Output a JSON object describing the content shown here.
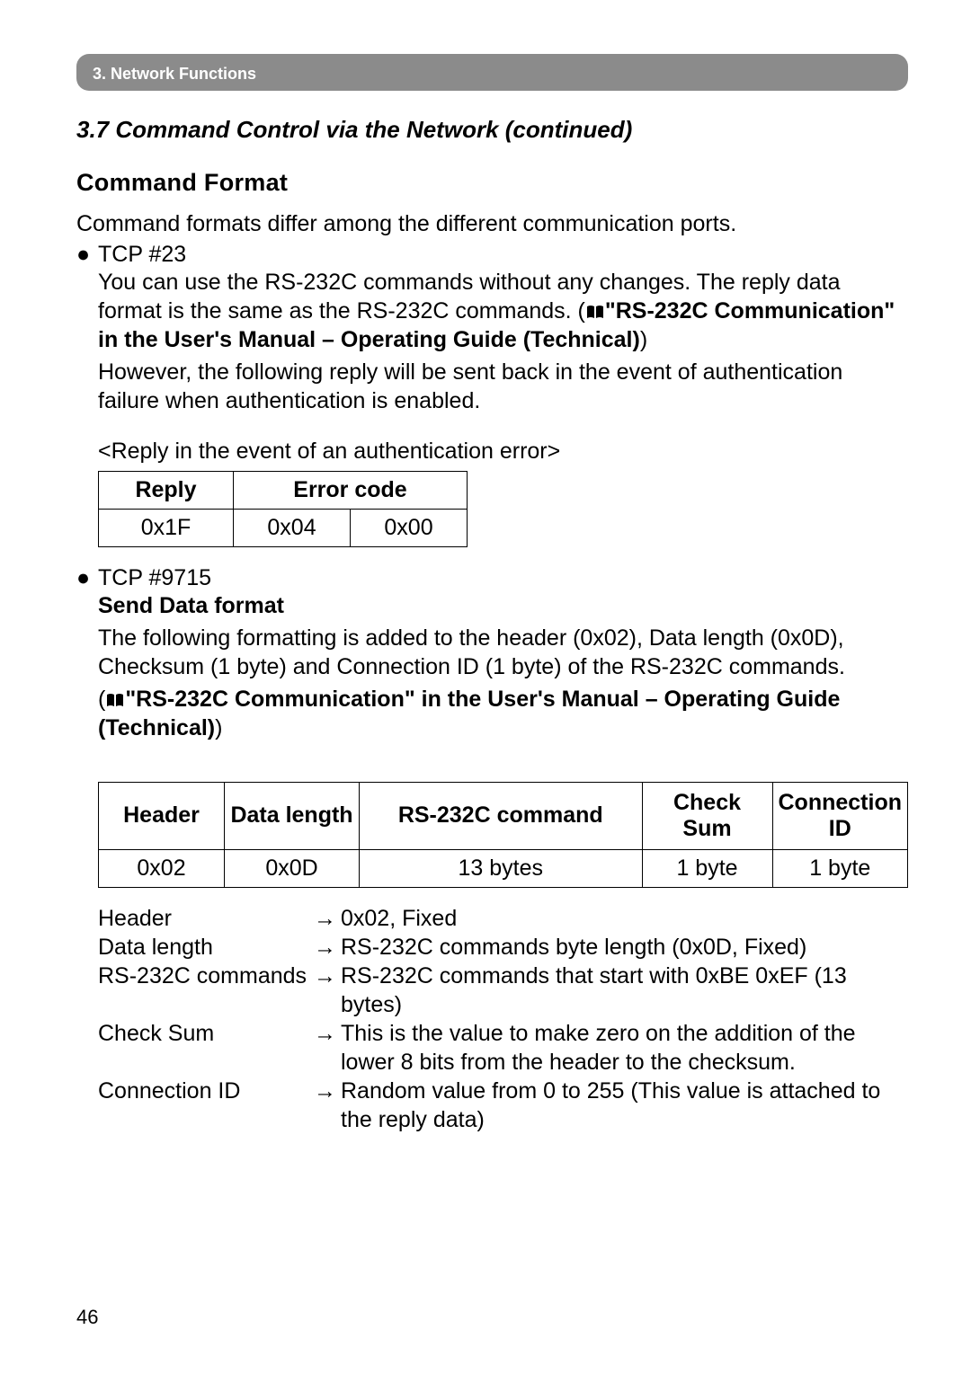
{
  "chapter": "3. Network Functions",
  "sectionTitle": "3.7 Command Control via the Network (continued)",
  "heading": "Command Format",
  "intro": "Command formats differ among the different communication ports.",
  "tcp23": {
    "label": "TCP #23",
    "line1": "You can use the RS-232C commands without any changes. The reply data format is the same as the RS-232C commands. (",
    "crossref": "\"RS-232C Communication\" in the User's Manual – Operating Guide (Technical)",
    "line1end": ")",
    "line2": "However, the following reply will be sent back in the event of authentication failure when authentication is enabled.",
    "replyCaption": "<Reply in the event of an authentication error>",
    "table": {
      "headers": [
        "Reply",
        "Error code"
      ],
      "row": [
        "0x1F",
        "0x04",
        "0x00"
      ]
    }
  },
  "tcp9715": {
    "label": "TCP #9715",
    "subheading": "Send Data format",
    "line1": "The following formatting is added to the header (0x02), Data length (0x0D), Checksum (1 byte) and Connection ID (1 byte) of the RS-232C commands.",
    "crossrefOpen": "(",
    "crossref": "\"RS-232C Communication\" in the User's Manual – Operating Guide (Technical)",
    "crossrefClose": ")",
    "table": {
      "headers": [
        "Header",
        "Data length",
        "RS-232C command",
        "Check Sum",
        "Connection ID"
      ],
      "row": [
        "0x02",
        "0x0D",
        "13 bytes",
        "1 byte",
        "1 byte"
      ]
    },
    "defs": [
      {
        "label": "Header",
        "value": "0x02, Fixed"
      },
      {
        "label": "Data length",
        "value": "RS-232C commands byte length (0x0D, Fixed)"
      },
      {
        "label": "RS-232C commands",
        "value": "RS-232C commands that start with 0xBE 0xEF (13 bytes)"
      },
      {
        "label": "Check Sum",
        "value": "This is the value to make zero on the addition of the lower 8 bits from the header to the checksum."
      },
      {
        "label": "Connection ID",
        "value": "Random value from 0 to 255 (This value is attached to the reply data)"
      }
    ]
  },
  "arrow": "→",
  "bullet": "●",
  "pageNumber": "46"
}
